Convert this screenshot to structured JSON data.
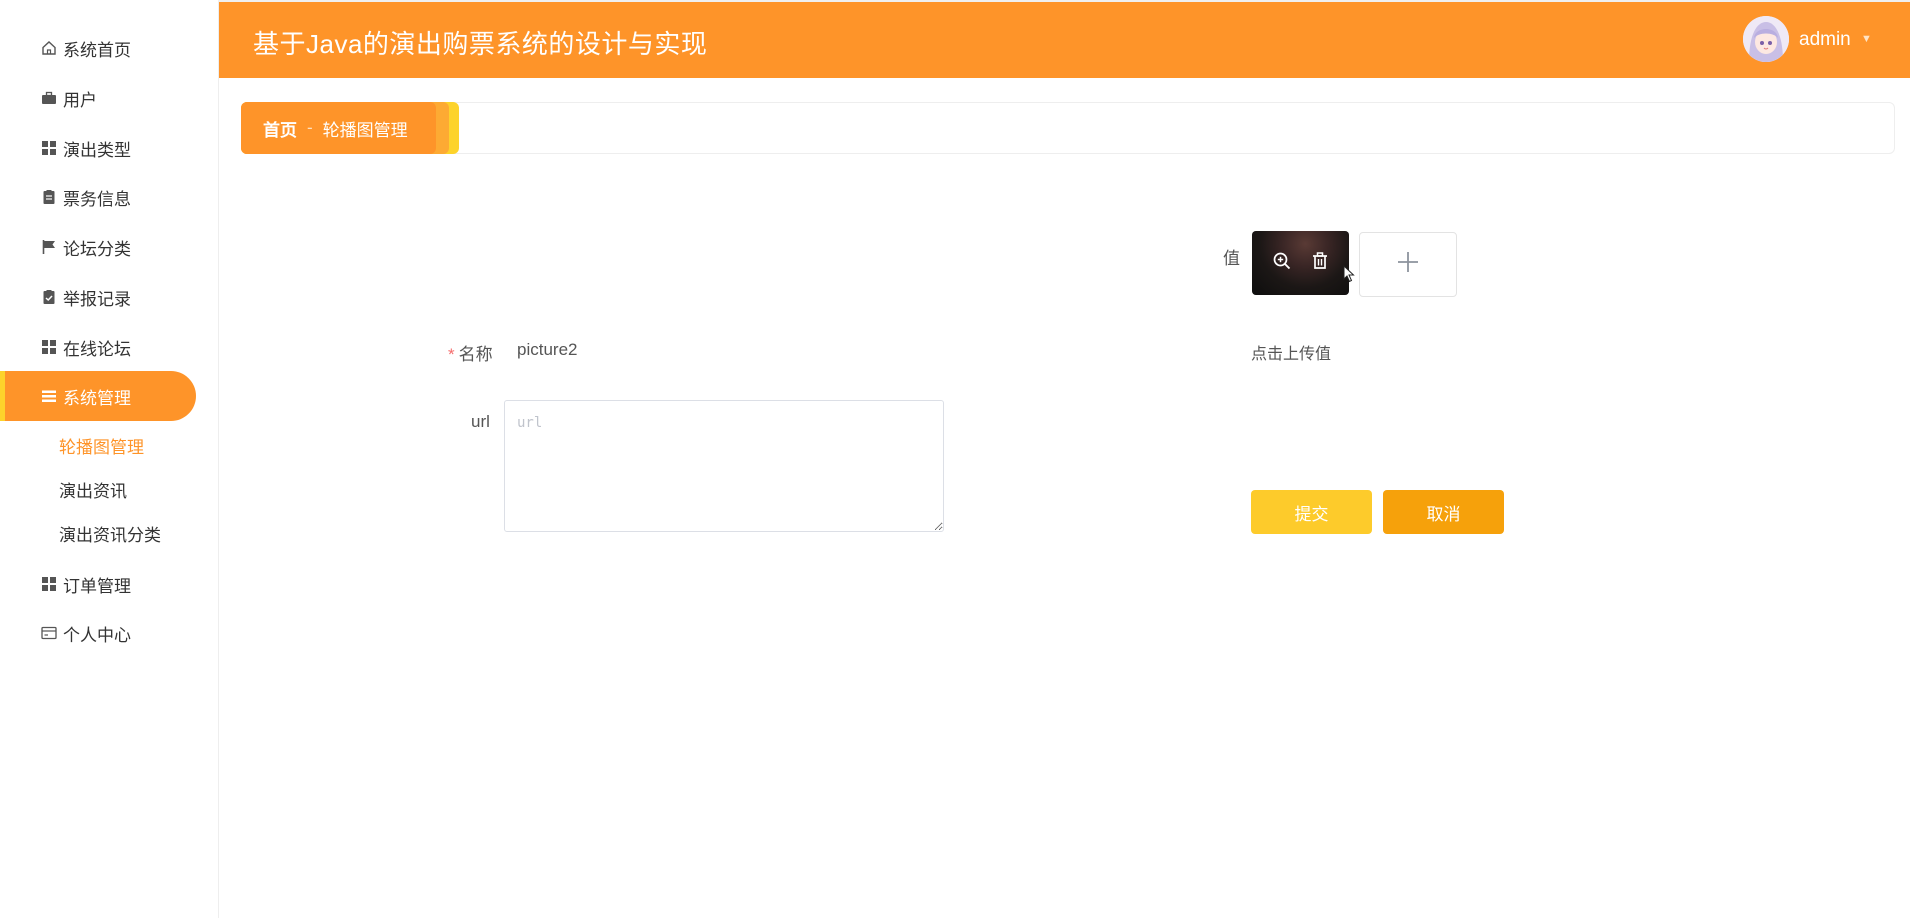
{
  "header": {
    "title": "基于Java的演出购票系统的设计与实现",
    "user_name": "admin"
  },
  "sidebar": {
    "items": [
      {
        "label": "系统首页",
        "icon": "home-icon"
      },
      {
        "label": "用户",
        "icon": "briefcase-icon"
      },
      {
        "label": "演出类型",
        "icon": "grid-icon"
      },
      {
        "label": "票务信息",
        "icon": "clipboard-icon"
      },
      {
        "label": "论坛分类",
        "icon": "flag-icon"
      },
      {
        "label": "举报记录",
        "icon": "clipboard-check-icon"
      },
      {
        "label": "在线论坛",
        "icon": "grid-icon"
      },
      {
        "label": "系统管理",
        "icon": "menu-icon",
        "active": true
      },
      {
        "label": "订单管理",
        "icon": "grid-icon"
      },
      {
        "label": "个人中心",
        "icon": "card-icon"
      }
    ],
    "sub_items": [
      {
        "label": "轮播图管理",
        "active": true
      },
      {
        "label": "演出资讯"
      },
      {
        "label": "演出资讯分类"
      }
    ]
  },
  "breadcrumb": {
    "home": "首页",
    "separator": "-",
    "current": "轮播图管理"
  },
  "form": {
    "value_label": "值",
    "name_label": "名称",
    "name_value": "picture2",
    "url_label": "url",
    "url_placeholder": "url",
    "upload_hint": "点击上传值",
    "submit_label": "提交",
    "cancel_label": "取消"
  },
  "colors": {
    "primary": "#fe9429",
    "accent": "#fdd32b",
    "submit": "#fdcb2b",
    "cancel": "#f6a10b"
  }
}
